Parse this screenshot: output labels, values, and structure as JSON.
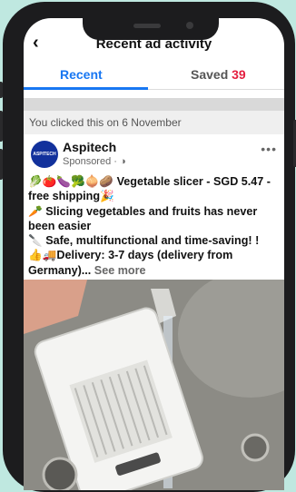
{
  "header": {
    "title": "Recent ad activity"
  },
  "tabs": [
    {
      "label": "Recent"
    },
    {
      "label": "Saved",
      "count": "39"
    }
  ],
  "notice": "You clicked this on 6 November",
  "post": {
    "page_name": "Aspitech",
    "avatar_text": "ASPITECH",
    "sponsored_label": "Sponsored",
    "line1_emojis": "🥬🍅🍆🥦🧅🥔",
    "line1_text": "Vegetable slicer - SGD 5.47 - free shipping",
    "line1_end_emoji": "🎉",
    "line2_emoji": "🥕",
    "line2_text": "Slicing vegetables and fruits has never been easier",
    "line3_emoji": "🔪",
    "line3_text": "Safe, multifunctional and time-saving! !",
    "line4_emojis": "👍🚚",
    "line4_text": "Delivery: 3-7 days (delivery from Germany)...",
    "see_more": "See more"
  },
  "colors": {
    "accent": "#1877f2",
    "saved_count": "#e41e3f",
    "phone_frame": "#1c1c1e",
    "background": "#bfe8e0"
  }
}
